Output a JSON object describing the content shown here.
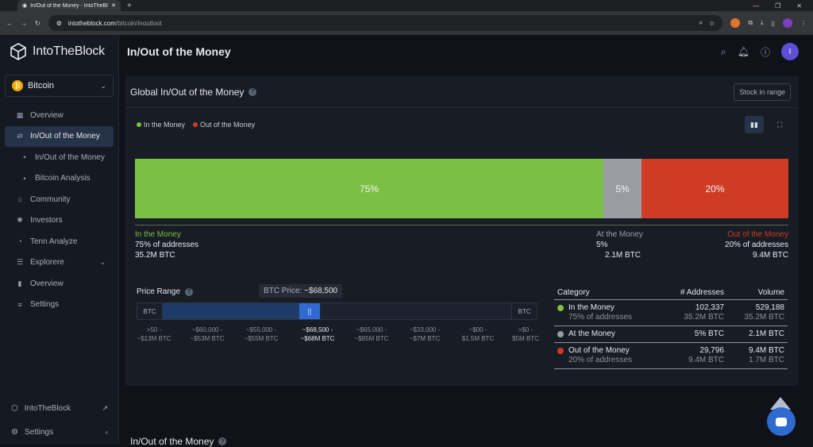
{
  "browser": {
    "tab_title": "In/Out of the Money - IntoTheBl...",
    "url_host": "intotheblock.com",
    "url_path": "/bitcoin/inoutloot"
  },
  "sidebar": {
    "logo": "IntoTheBlock",
    "asset": "Bitcoin",
    "items": [
      {
        "label": "Overview"
      },
      {
        "label": "In/Out of the Money"
      },
      {
        "label": "In/Out of the Money"
      },
      {
        "label": "Bitcoin Analysis"
      },
      {
        "label": "Community"
      },
      {
        "label": "Investors"
      },
      {
        "label": "Tenn Analyze"
      },
      {
        "label": "Explorere"
      },
      {
        "label": "Overview"
      },
      {
        "label": "Settings"
      }
    ],
    "bottom": [
      {
        "label": "IntoTheBlock"
      },
      {
        "label": "Settings"
      }
    ]
  },
  "header": {
    "title": "In/Out of the Money",
    "avatar": "I"
  },
  "card": {
    "title": "Global In/Out of the Money",
    "stock_button": "Stock in range",
    "legend": [
      {
        "label": "In the Money",
        "color": "#7bc043"
      },
      {
        "label": "Out of the Money",
        "color": "#d03b25"
      }
    ]
  },
  "chart_data": {
    "type": "bar",
    "orientation": "horizontal-stacked",
    "categories": [
      "In the Money",
      "At the Money",
      "Out of the Money"
    ],
    "values": [
      75,
      5,
      20
    ],
    "value_labels": [
      "75%",
      "5%",
      "20%"
    ],
    "colors": [
      "#7bc043",
      "#9a9ca1",
      "#d03b25"
    ],
    "segment_labels": {
      "in": {
        "name": "In the Money",
        "addresses": "75% of addresses",
        "volume": "35.2M BTC"
      },
      "at": {
        "name": "At the Money",
        "addresses": "5%",
        "volume": "2.1M BTC"
      },
      "out": {
        "name": "Out of the Money",
        "addresses": "20% of addresses",
        "volume": "9.4M BTC"
      }
    }
  },
  "price_range": {
    "title": "Price Range",
    "btc_price_label": "BTC Price:",
    "btc_price_value": "~$68,500",
    "left_cap": "BTC",
    "right_cap": "BTC",
    "handle": "||",
    "ticks": [
      {
        "price": ">50 -",
        "vol": "~$13M BTC"
      },
      {
        "price": "~$60,000 -",
        "vol": "~$53M BTC"
      },
      {
        "price": "~$55,000 -",
        "vol": "~$55M BTC"
      },
      {
        "price": "~$68,500 -",
        "vol": "~$68M BTC"
      },
      {
        "price": "~$65,000 -",
        "vol": "~$85M BTC"
      },
      {
        "price": "~$33,000 -",
        "vol": "~$7M BTC"
      },
      {
        "price": "~$00 -",
        "vol": "$1.5M BTC"
      },
      {
        "price": ">$0 -",
        "vol": "$5M BTC"
      }
    ]
  },
  "table": {
    "headers": [
      "Category",
      "# Addresses",
      "Volume"
    ],
    "rows": [
      {
        "category": "In the Money",
        "sub": "75% of addresses",
        "addresses": "102,337",
        "addresses_sub": "35.2M BTC",
        "volume": "529,188",
        "volume_sub": "35.2M BTC",
        "color": "#7bc043"
      },
      {
        "category": "At the Money",
        "sub": "",
        "addresses": "5% BTC",
        "addresses_sub": "",
        "volume": "2.1M BTC",
        "volume_sub": "",
        "color": "#9a9ca1"
      },
      {
        "category": "Out of the Money",
        "sub": "20% of addresses",
        "addresses": "29,796",
        "addresses_sub": "9.4M BTC",
        "volume": "9.4M BTC",
        "volume_sub": "1.7M BTC",
        "color": "#d03b25"
      }
    ]
  },
  "section2": {
    "title": "In/Out of the Money"
  }
}
